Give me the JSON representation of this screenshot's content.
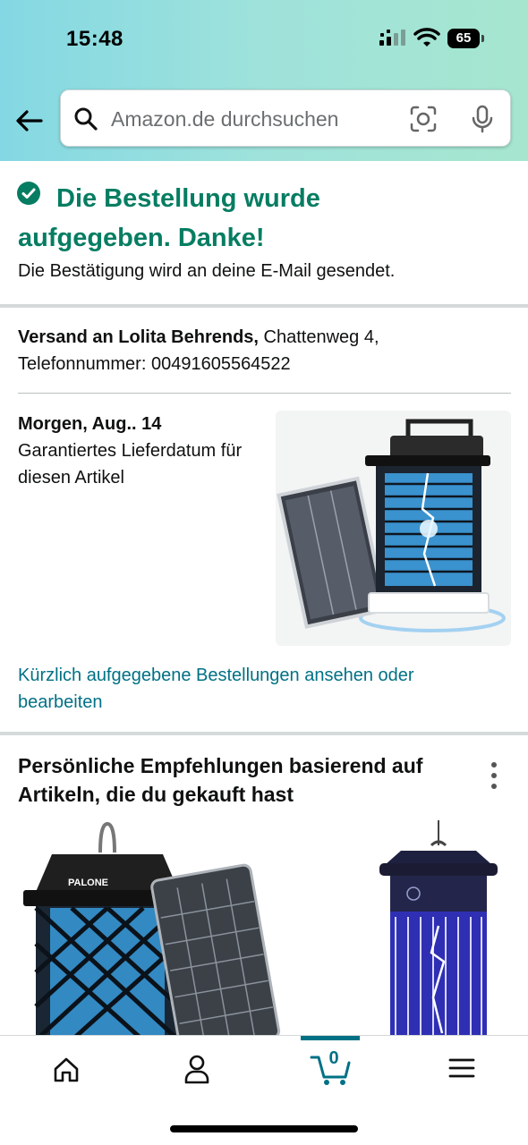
{
  "status_bar": {
    "time": "15:48",
    "battery": "65"
  },
  "search": {
    "placeholder": "Amazon.de durchsuchen"
  },
  "confirmation": {
    "title": "Die Bestellung wurde aufgegeben. Danke!",
    "subtitle": "Die Bestätigung wird an deine E-Mail gesendet."
  },
  "shipping": {
    "label": "Versand an Lolita Behrends,",
    "address": "Chattenweg 4,",
    "phone": "Telefonnummer: 00491605564522"
  },
  "delivery": {
    "date": "Morgen, Aug.. 14",
    "note": "Garantiertes Lieferdatum für diesen Artikel"
  },
  "orders_link": "Kürzlich aufgegebene Bestellungen ansehen oder bearbeiten",
  "recommendations": {
    "title": "Persönliche Empfehlungen basierend auf Artikeln, die du gekauft hast",
    "brand_label": "PALONE"
  },
  "bottom_nav": {
    "items": [
      "home-icon",
      "account-icon",
      "cart-icon",
      "menu-icon"
    ],
    "cart_count": "0"
  },
  "colors": {
    "success": "#067d62",
    "link": "#007185",
    "header_gradient": [
      "#84d8e3",
      "#a6e6cf"
    ]
  }
}
